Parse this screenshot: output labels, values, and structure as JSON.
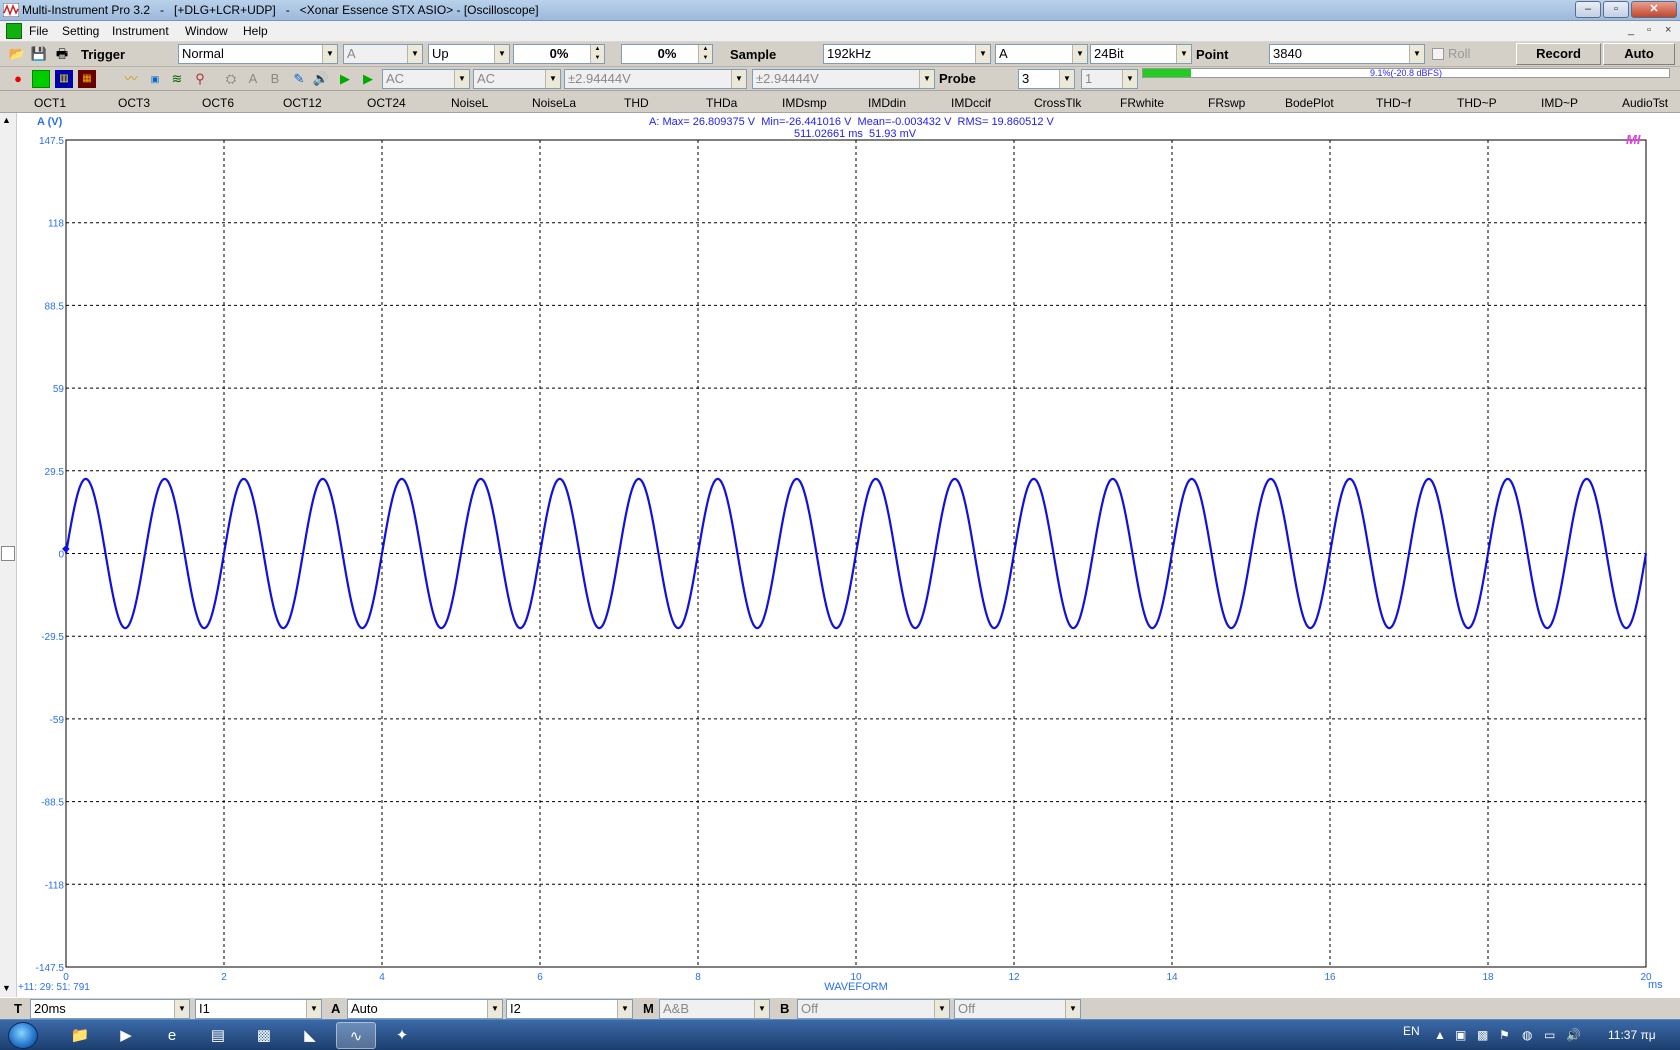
{
  "window": {
    "title": "Multi-Instrument Pro 3.2   -   [+DLG+LCR+UDP]   -   <Xonar Essence STX ASIO> - [Oscilloscope]",
    "buttons": [
      "–",
      "▫",
      "✕"
    ]
  },
  "menu": {
    "items": [
      "File",
      "Setting",
      "Instrument",
      "Window",
      "Help"
    ],
    "mdi_buttons": [
      "_",
      "▫",
      "×"
    ]
  },
  "toolbar1": {
    "trigger_label": "Trigger",
    "trigger_mode": "Normal",
    "trigger_channel": "A",
    "trigger_edge": "Up",
    "trigger_level_1": "0%",
    "trigger_level_2": "0%",
    "sample_label": "Sample",
    "sample_rate": "192kHz",
    "sample_channel": "A",
    "bit_depth": "24Bit",
    "point_label": "Point",
    "points": "3840",
    "roll_label": "Roll",
    "record_label": "Record",
    "auto_label": "Auto"
  },
  "toolbar2": {
    "coupling_a": "AC",
    "coupling_b": "AC",
    "range_a": "±2.94444V",
    "range_b": "±2.94444V",
    "probe_label": "Probe",
    "probe_value": "3",
    "probe_b_value": "1",
    "level_text": "9.1%(-20.8 dBFS)",
    "level_fraction": 0.091
  },
  "functions": [
    "OCT1",
    "OCT3",
    "OCT6",
    "OCT12",
    "OCT24",
    "NoiseL",
    "NoiseLa",
    "THD",
    "THDa",
    "IMDsmp",
    "IMDdin",
    "IMDccif",
    "CrossTlk",
    "FRwhite",
    "FRswp",
    "BodePlot",
    "THD~f",
    "THD~P",
    "IMD~P",
    "AudioTst"
  ],
  "plot": {
    "y_axis_label": "A (V)",
    "stats_line": "A: Max= 26.809375 V  Min=-26.441016 V  Mean=-0.003432 V  RMS= 19.860512 V",
    "cursor_line": "511.02661 ms  51.93 mV",
    "timestamp": "+11: 29: 51: 791",
    "x_caption": "WAVEFORM",
    "x_unit": "ms",
    "corner_logo": "MI"
  },
  "statusbar": {
    "t_label": "T",
    "timebase": "20ms",
    "ch1": "I1",
    "a_label": "A",
    "a_mode": "Auto",
    "ch2": "I2",
    "m_label": "M",
    "m_mode": "A&B",
    "b_label": "B",
    "b_mode": "Off",
    "b_mode2": "Off"
  },
  "taskbar": {
    "lang": "EN",
    "clock": "11:37 πμ"
  },
  "colors": {
    "trace": "#1010e0",
    "axis_text": "#2a6ff0",
    "grid": "#000000",
    "level_fill": "#22cc22"
  },
  "chart_data": {
    "type": "line",
    "ylabel": "A (V)",
    "xlabel": "WAVEFORM",
    "x_unit": "ms",
    "xlim": [
      0,
      20
    ],
    "ylim": [
      -147.5,
      147.5
    ],
    "x_ticks": [
      0,
      2,
      4,
      6,
      8,
      10,
      12,
      14,
      16,
      18,
      20
    ],
    "y_ticks": [
      "147.5",
      "118",
      "88.5",
      "59",
      "29.5",
      "0",
      "-29.5",
      "-59",
      "-88.5",
      "-118",
      "-147.5"
    ],
    "grid": true,
    "series": [
      {
        "waveform": "sine",
        "amplitude": 26.6,
        "frequency_hz": 1000,
        "x_start": 0,
        "x_end": 20
      }
    ]
  }
}
